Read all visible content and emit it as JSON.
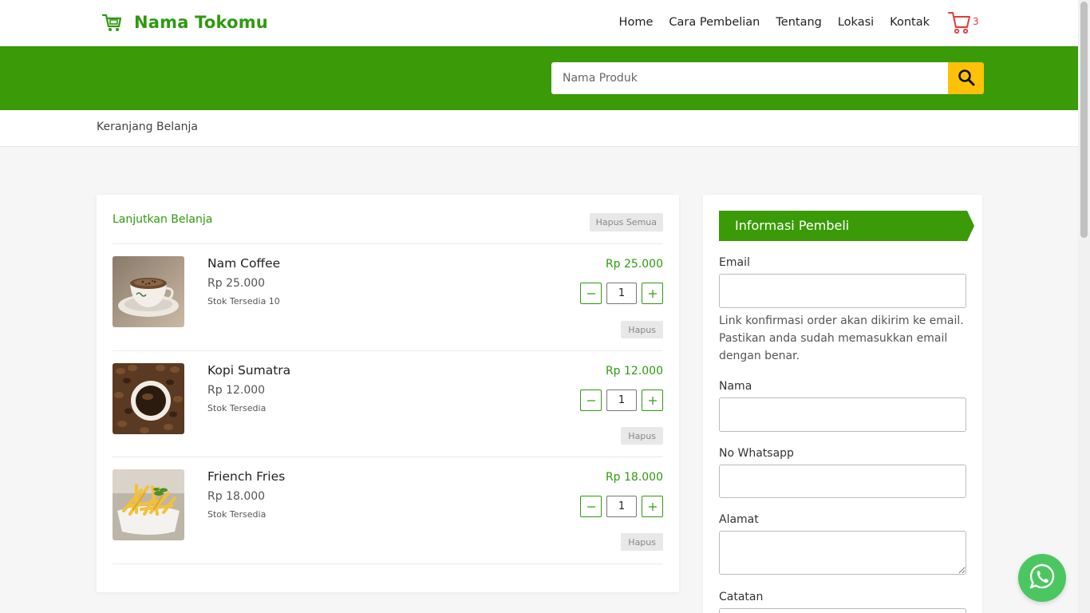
{
  "brand": {
    "name": "Nama Tokomu",
    "icon": "cart-icon"
  },
  "nav": {
    "items": [
      {
        "label": "Home"
      },
      {
        "label": "Cara Pembelian"
      },
      {
        "label": "Tentang"
      },
      {
        "label": "Lokasi"
      },
      {
        "label": "Kontak"
      }
    ],
    "cart_count": "3",
    "cart_icon": "cart-icon"
  },
  "search": {
    "placeholder": "Nama Produk",
    "button_icon": "search-icon"
  },
  "breadcrumb": {
    "label": "Keranjang Belanja"
  },
  "cart": {
    "continue_label": "Lanjutkan Belanja",
    "clear_all_label": "Hapus Semua",
    "items": [
      {
        "name": "Nam Coffee",
        "price": "Rp 25.000",
        "stock": "Stok Tersedia 10",
        "total": "Rp 25.000",
        "qty": "1",
        "delete_label": "Hapus",
        "image": "coffee-cup-image"
      },
      {
        "name": "Kopi Sumatra",
        "price": "Rp 12.000",
        "stock": "Stok Tersedia",
        "total": "Rp 12.000",
        "qty": "1",
        "delete_label": "Hapus",
        "image": "coffee-beans-image"
      },
      {
        "name": "Friench Fries",
        "price": "Rp 18.000",
        "stock": "Stok Tersedia",
        "total": "Rp 18.000",
        "qty": "1",
        "delete_label": "Hapus",
        "image": "french-fries-image"
      }
    ]
  },
  "buyer": {
    "title": "Informasi Pembeli",
    "email_label": "Email",
    "email_help": "Link konfirmasi order akan dikirim ke email. Pastikan anda sudah memasukkan email dengan benar.",
    "name_label": "Nama",
    "whatsapp_label": "No Whatsapp",
    "address_label": "Alamat",
    "note_label": "Catatan"
  },
  "colors": {
    "brand_green": "#3a9a07",
    "accent_yellow": "#ffc107",
    "whatsapp_green": "#4cc661",
    "badge_red": "#e53935"
  }
}
